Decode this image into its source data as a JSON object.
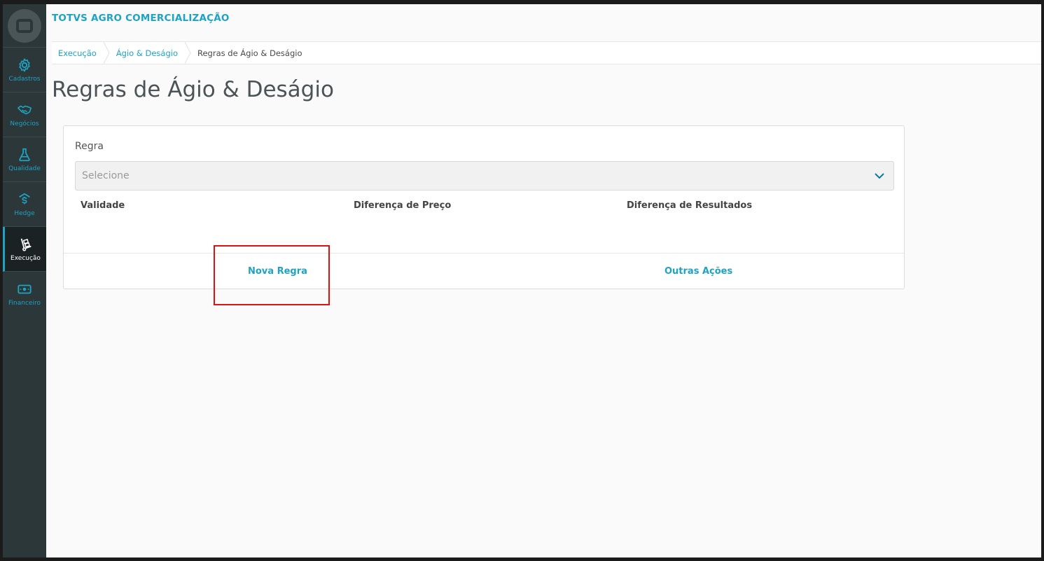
{
  "app": {
    "title": "TOTVS AGRO COMERCIALIZAÇÃO"
  },
  "sidebar": {
    "logo_icon": "totvs-logo-icon",
    "items": [
      {
        "label": "Cadastros",
        "icon": "gear-icon",
        "active": false
      },
      {
        "label": "Negócios",
        "icon": "handshake-icon",
        "active": false
      },
      {
        "label": "Qualidade",
        "icon": "flask-icon",
        "active": false
      },
      {
        "label": "Hedge",
        "icon": "dollar-shield-icon",
        "active": false
      },
      {
        "label": "Execução",
        "icon": "hand-truck-icon",
        "active": true
      },
      {
        "label": "Financeiro",
        "icon": "banknote-icon",
        "active": false
      }
    ]
  },
  "breadcrumb": [
    {
      "label": "Execução"
    },
    {
      "label": "Ágio & Deságio"
    },
    {
      "label": "Regras de Ágio & Deságio"
    }
  ],
  "page": {
    "title": "Regras de Ágio & Deságio"
  },
  "form": {
    "regra_label": "Regra",
    "select_placeholder": "Selecione",
    "columns": [
      "Validade",
      "Diferença de Preço",
      "Diferença de Resultados"
    ]
  },
  "actions": {
    "primary": "Nova Regra",
    "secondary": "Outras Ações"
  },
  "colors": {
    "accent": "#1fa3c3",
    "sidebar_bg": "#2c3739",
    "highlight": "#e01010"
  }
}
